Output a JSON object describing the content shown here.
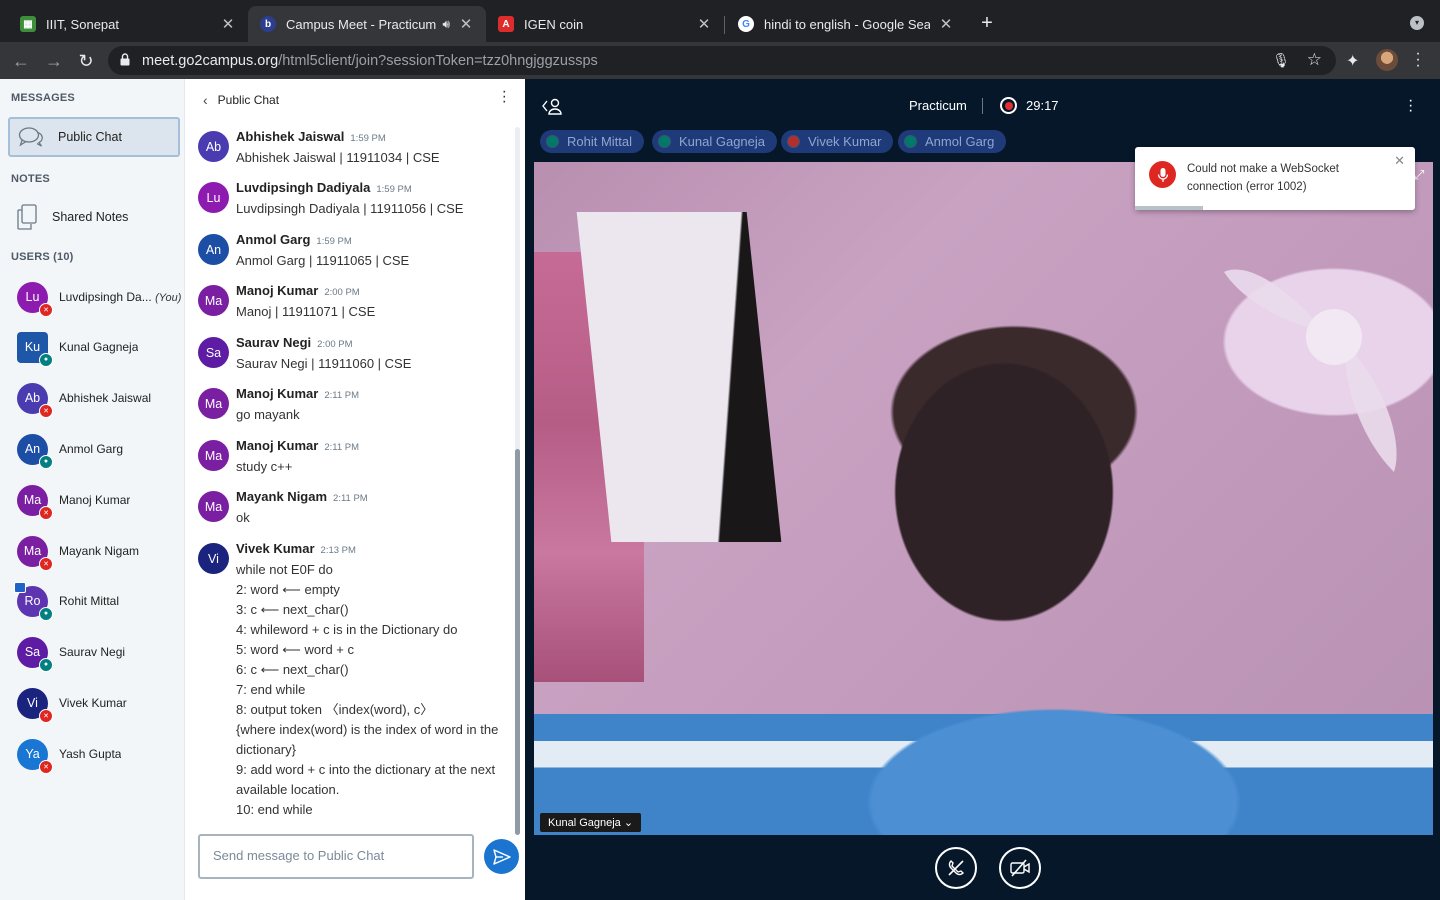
{
  "browser": {
    "tabs": [
      {
        "title": "IIIT, Sonepat",
        "active": false
      },
      {
        "title": "Campus Meet - Practicum",
        "active": true
      },
      {
        "title": "IGEN coin",
        "active": false
      },
      {
        "title": "hindi to english - Google Search",
        "active": false
      }
    ],
    "url_host": "meet.go2campus.org",
    "url_path": "/html5client/join?sessionToken=tzz0hngjggzussps"
  },
  "sidebar": {
    "messages_title": "MESSAGES",
    "public_chat_label": "Public Chat",
    "notes_title": "NOTES",
    "shared_notes_label": "Shared Notes",
    "users_title": "USERS (10)",
    "users": [
      {
        "initials": "Lu",
        "name": "Luvdipsingh Da...",
        "suffix": "(You)",
        "color": "#8e1bb0",
        "status": "muted",
        "shape": "circle",
        "presenter": false
      },
      {
        "initials": "Ku",
        "name": "Kunal Gagneja",
        "suffix": "",
        "color": "#1e56a8",
        "status": "on",
        "shape": "square",
        "presenter": false
      },
      {
        "initials": "Ab",
        "name": "Abhishek Jaiswal",
        "suffix": "",
        "color": "#4a3bb0",
        "status": "muted",
        "shape": "circle",
        "presenter": false
      },
      {
        "initials": "An",
        "name": "Anmol Garg",
        "suffix": "",
        "color": "#1c4ea5",
        "status": "on",
        "shape": "circle",
        "presenter": false
      },
      {
        "initials": "Ma",
        "name": "Manoj Kumar",
        "suffix": "",
        "color": "#7b1fa2",
        "status": "muted",
        "shape": "circle",
        "presenter": false
      },
      {
        "initials": "Ma",
        "name": "Mayank Nigam",
        "suffix": "",
        "color": "#7b1fa2",
        "status": "muted",
        "shape": "circle",
        "presenter": false
      },
      {
        "initials": "Ro",
        "name": "Rohit Mittal",
        "suffix": "",
        "color": "#5e35b1",
        "status": "on",
        "shape": "circle",
        "presenter": true
      },
      {
        "initials": "Sa",
        "name": "Saurav Negi",
        "suffix": "",
        "color": "#5e1ca5",
        "status": "on",
        "shape": "circle",
        "presenter": false
      },
      {
        "initials": "Vi",
        "name": "Vivek Kumar",
        "suffix": "",
        "color": "#1a237e",
        "status": "muted",
        "shape": "circle",
        "presenter": false
      },
      {
        "initials": "Ya",
        "name": "Yash Gupta",
        "suffix": "",
        "color": "#1976d2",
        "status": "muted",
        "shape": "circle",
        "presenter": false
      }
    ]
  },
  "chat": {
    "title": "Public Chat",
    "messages": [
      {
        "initials": "Ab",
        "color": "#4a3bb0",
        "name": "Abhishek Jaiswal",
        "time": "1:59 PM",
        "lines": [
          "Abhishek Jaiswal | 11911034 | CSE"
        ]
      },
      {
        "initials": "Lu",
        "color": "#8e1bb0",
        "name": "Luvdipsingh Dadiyala",
        "time": "1:59 PM",
        "lines": [
          "Luvdipsingh Dadiyala | 11911056 | CSE"
        ]
      },
      {
        "initials": "An",
        "color": "#1c4ea5",
        "name": "Anmol Garg",
        "time": "1:59 PM",
        "lines": [
          "Anmol Garg | 11911065 | CSE"
        ]
      },
      {
        "initials": "Ma",
        "color": "#7b1fa2",
        "name": "Manoj Kumar",
        "time": "2:00 PM",
        "lines": [
          "Manoj | 11911071 | CSE"
        ]
      },
      {
        "initials": "Sa",
        "color": "#5e1ca5",
        "name": "Saurav Negi",
        "time": "2:00 PM",
        "lines": [
          "Saurav Negi | 11911060 | CSE"
        ]
      },
      {
        "initials": "Ma",
        "color": "#7b1fa2",
        "name": "Manoj Kumar",
        "time": "2:11 PM",
        "lines": [
          "go mayank"
        ]
      },
      {
        "initials": "Ma",
        "color": "#7b1fa2",
        "name": "Manoj Kumar",
        "time": "2:11 PM",
        "lines": [
          "study c++"
        ]
      },
      {
        "initials": "Ma",
        "color": "#7b1fa2",
        "name": "Mayank Nigam",
        "time": "2:11 PM",
        "lines": [
          "ok"
        ]
      },
      {
        "initials": "Vi",
        "color": "#1a237e",
        "name": "Vivek Kumar",
        "time": "2:13 PM",
        "lines": [
          "while not E0F do",
          "2: word ⟵ empty",
          "3: c ⟵ next_char()",
          "4: whileword + c is in the Dictionary do",
          "5: word ⟵ word + c",
          "6: c ⟵ next_char()",
          "7: end while",
          "8: output token 〈index(word), c〉",
          "{where index(word) is the index of word in the",
          "dictionary}",
          "9: add word + c into the dictionary at the next",
          "available location.",
          "10: end while"
        ]
      }
    ],
    "input_placeholder": "Send message to Public Chat"
  },
  "media": {
    "meeting_title": "Practicum",
    "recording_time": "29:17",
    "talkers": [
      {
        "name": "Rohit Mittal",
        "muted": false
      },
      {
        "name": "Kunal Gagneja",
        "muted": false
      },
      {
        "name": "Vivek Kumar",
        "muted": true
      },
      {
        "name": "Anmol Garg",
        "muted": false
      }
    ],
    "video_user": "Kunal Gagneja",
    "toast_message": "Could not make a WebSocket connection (error 1002)"
  }
}
